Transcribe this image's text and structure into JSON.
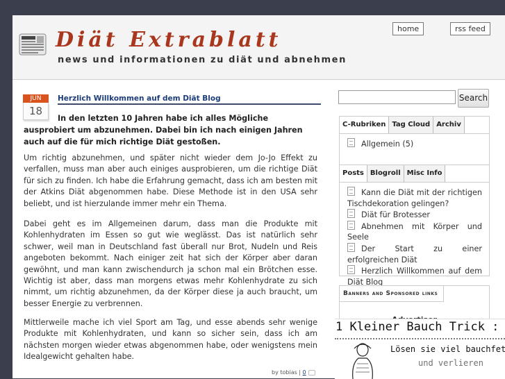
{
  "header": {
    "title": "Diät Extrablatt",
    "tagline": "news und informationen zu diät und abnehmen",
    "home_label": "home",
    "rss_label": "rss feed"
  },
  "post": {
    "month": "JUN",
    "day": "18",
    "title": "Herzlich Willkommen auf dem Diät Blog",
    "intro": "In den letzten 10 Jahren habe ich alles Mögliche ausprobiert um abzunehmen. Dabei bin ich nach einigen Jahren auch auf die für mich richtige Diät gestoßen.",
    "paragraphs": [
      "Um richtig abzunehmen, und später nicht wieder dem Jo-Jo Effekt zu verfallen, muss man aber auch einiges ausprobieren, um die richtige Diät für sich zu finden.  Ich habe die Erfahrung gemacht, dass ich am besten mit der Atkins Diät abgenommen habe. Diese Methode ist in den USA sehr beliebt, und ist hierzulande immer mehr ein Thema.",
      "Dabei geht es im Allgemeinen darum, dass man die Produkte mit Kohlenhydraten im Essen so gut wie weglässt. Das ist natürlich sehr schwer, weil man in Deutschland fast überall nur Brot, Nudeln und Reis angeboten bekommt. Nach einiger zeit hat sich der Körper aber daran gewöhnt, und man kann zwischendurch ja schon mal ein Brötchen esse. Wichtig ist aber, dass man morgens etwas mehr Kohlenhydrate zu sich nimmt, um richtig abzunehmen, da der Körper diese ja auch braucht, um besser Energie zu verbrennen.",
      "Mittlerweile mache ich viel Sport am Tag, und esse abends sehr wenige Produkte mit Kohlenhydraten, und kann so sicher sein, dass ich am nächsten morgen wieder etwas abgenommen habe, oder wenigstens mein Idealgewicht gehalten habe."
    ],
    "meta_by": "by tobias |",
    "comment_count": "0"
  },
  "sidebar": {
    "search_placeholder": "",
    "search_button": "Search",
    "box1_tabs": [
      "C-Rubriken",
      "Tag Cloud",
      "Archiv"
    ],
    "categories": [
      "Allgemein (5)"
    ],
    "box2_tabs": [
      "Posts",
      "Blogroll",
      "Misc Info"
    ],
    "posts": [
      "Kann die Diät mit der richtigen Tischdekoration gelingen?",
      "Diät für Brotesser",
      "Abnehmen mit Körper und Seele",
      "Der Start zu einer erfolgreichen Diät",
      "Herzlich Willkommen auf dem Diät Blog"
    ],
    "banners_title": "Banners and Sponsored links",
    "advertiser_label": "Advertiser",
    "ad_headline": "1 Kleiner Bauch Trick :",
    "ad_text": "Lösen sie viel bauchfett",
    "ad_text2": "und verlieren"
  }
}
